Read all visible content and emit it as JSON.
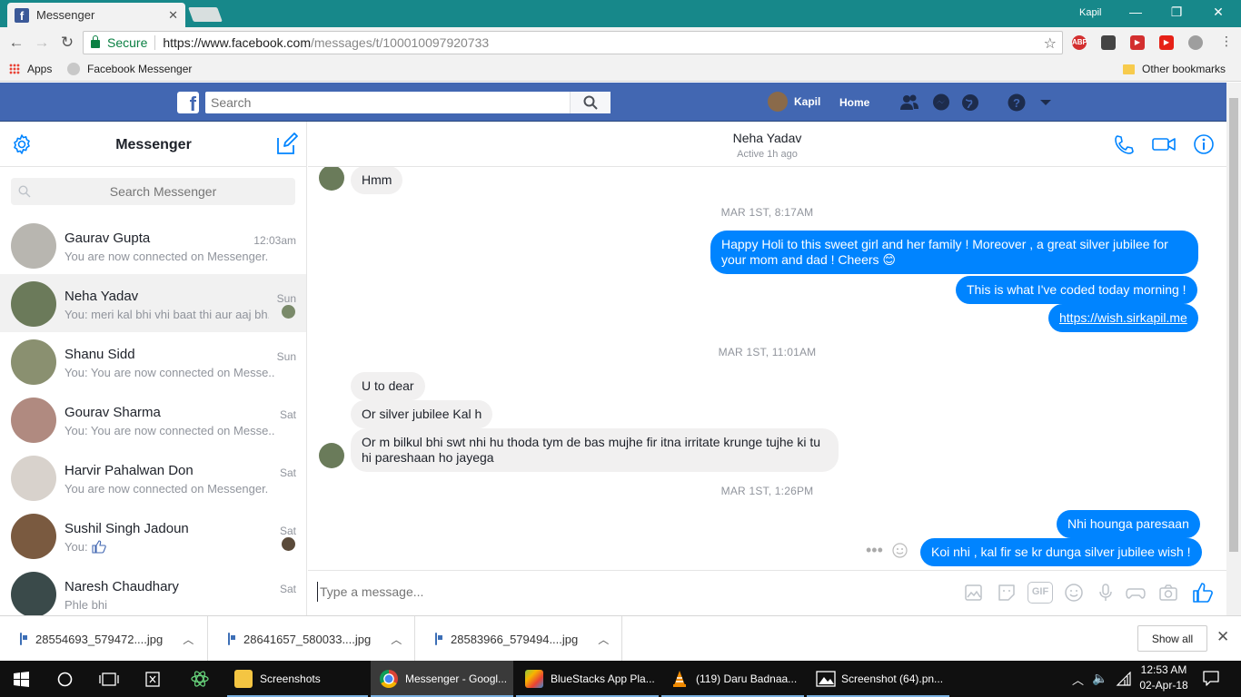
{
  "browser": {
    "tab_title": "Messenger",
    "window_user": "Kapil",
    "secure_label": "Secure",
    "url_host": "https://www.facebook.com",
    "url_path": "/messages/t/100010097920733",
    "ext_abp": "ABP"
  },
  "bookmarks": {
    "apps": "Apps",
    "facebook_messenger": "Facebook Messenger",
    "other": "Other bookmarks"
  },
  "fb": {
    "logo": "f",
    "search_placeholder": "Search",
    "user_name": "Kapil",
    "home": "Home"
  },
  "left": {
    "title": "Messenger",
    "search_placeholder": "Search Messenger",
    "conversations": [
      {
        "name": "Gaurav Gupta",
        "time": "12:03am",
        "snippet": "You are now connected on Messenger."
      },
      {
        "name": "Neha Yadav",
        "time": "Sun",
        "snippet": "You: meri kal bhi vhi baat thi aur aaj bh..."
      },
      {
        "name": "Shanu Sidd",
        "time": "Sun",
        "snippet": "You: You are now connected on Messe..."
      },
      {
        "name": "Gourav Sharma",
        "time": "Sat",
        "snippet": "You: You are now connected on Messe..."
      },
      {
        "name": "Harvir Pahalwan Don",
        "time": "Sat",
        "snippet": "You are now connected on Messenger."
      },
      {
        "name": "Sushil Singh Jadoun",
        "time": "Sat",
        "snippet": "You:"
      },
      {
        "name": "Naresh Chaudhary",
        "time": "Sat",
        "snippet": "Phle bhi"
      }
    ]
  },
  "chat": {
    "name": "Neha Yadav",
    "status": "Active 1h ago",
    "messages": {
      "m0": "Hmm",
      "ts1": "MAR 1ST, 8:17AM",
      "m1": "Happy Holi to this sweet girl and her family ! Moreover , a great silver jubilee for your mom and dad ! Cheers 😊",
      "m2": "This is what I've coded today morning !",
      "m3": "https://wish.sirkapil.me",
      "ts2": "MAR 1ST, 11:01AM",
      "m4": "U to dear",
      "m5": "Or silver jubilee Kal h",
      "m6": "Or m bilkul bhi swt nhi hu thoda tym de bas mujhe fir itna irritate krunge tujhe ki tu hi pareshaan ho jayega",
      "ts3": "MAR 1ST, 1:26PM",
      "m7": "Nhi hounga paresaan",
      "m8": "Koi nhi , kal fir se kr dunga silver jubilee wish !"
    },
    "composer_placeholder": "Type a message...",
    "gif_label": "GIF"
  },
  "downloads": {
    "items": [
      "28554693_579472....jpg",
      "28641657_580033....jpg",
      "28583966_579494....jpg"
    ],
    "show_all": "Show all"
  },
  "taskbar": {
    "items": [
      {
        "label": "Screenshots"
      },
      {
        "label": "Messenger - Googl..."
      },
      {
        "label": "BlueStacks App Pla..."
      },
      {
        "label": "(119) Daru Badnaa..."
      },
      {
        "label": "Screenshot (64).pn..."
      }
    ],
    "time": "12:53 AM",
    "date": "02-Apr-18"
  },
  "colors": {
    "fb_blue": "#4267b2",
    "messenger_blue": "#0084ff",
    "chrome_teal": "#17888a"
  }
}
